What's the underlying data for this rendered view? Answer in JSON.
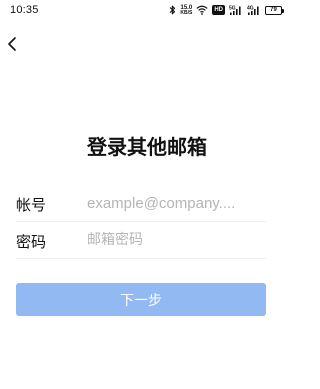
{
  "status_bar": {
    "time": "10:35",
    "net_speed_value": "15.0",
    "net_speed_unit": "KB/S",
    "hd_badge": "HD",
    "signal_1_label": "5G",
    "signal_2_label": "4G",
    "battery": "79",
    "icons": [
      "bluetooth-icon",
      "wifi-icon",
      "signal-icon",
      "signal-icon",
      "battery-icon"
    ]
  },
  "nav": {
    "back_icon": "chevron-left-icon"
  },
  "page": {
    "title": "登录其他邮箱"
  },
  "form": {
    "account_label": "帐号",
    "account_placeholder": "example@company....",
    "account_value": "",
    "password_label": "密码",
    "password_placeholder": "邮箱密码",
    "password_value": ""
  },
  "actions": {
    "next_label": "下一步"
  },
  "colors": {
    "primary_disabled": "#93b9f3",
    "placeholder": "#b5b5b5",
    "divider": "#efefef"
  }
}
